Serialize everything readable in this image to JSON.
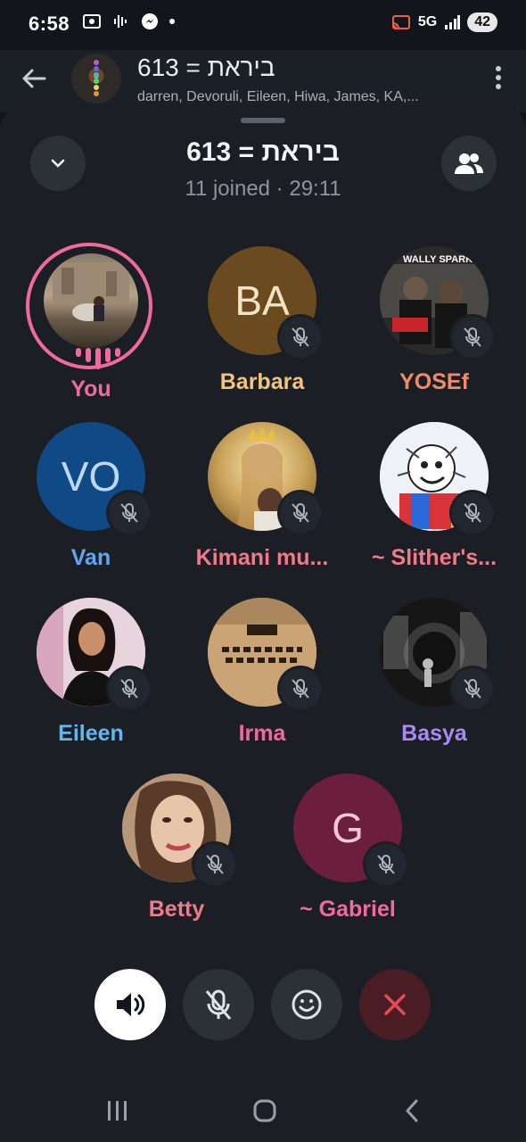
{
  "status_bar": {
    "time": "6:58",
    "network": "5G",
    "battery": "42"
  },
  "chat_header": {
    "title": "ביראת = 613",
    "subtitle": "darren, Devoruli, Eileen, Hiwa, James, KA,..."
  },
  "call": {
    "title": "ביראת = 613",
    "status": "11 joined · 29:11"
  },
  "participants": [
    {
      "name": "You",
      "color": "#f06a9c",
      "speaking": true,
      "initials": ""
    },
    {
      "name": "Barbara",
      "color": "#f3c47a",
      "initials": "BA",
      "bg": "#6a4a1e"
    },
    {
      "name": "YOSEf",
      "color": "#f08a6a",
      "initials": ""
    },
    {
      "name": "Van",
      "color": "#5fa8f0",
      "initials": "VO",
      "bg": "#0f4a86"
    },
    {
      "name": "Kimani mu...",
      "color": "#f07a8a",
      "initials": ""
    },
    {
      "name": "~ Slither's...",
      "color": "#f07a8a",
      "initials": ""
    },
    {
      "name": "Eileen",
      "color": "#5fb8f0",
      "initials": ""
    },
    {
      "name": "Irma",
      "color": "#f06a9c",
      "initials": ""
    },
    {
      "name": "Basya",
      "color": "#a88af0",
      "initials": ""
    },
    {
      "name": "Betty",
      "color": "#f07a8a",
      "initials": ""
    },
    {
      "name": "~ Gabriel",
      "color": "#f06a9c",
      "initials": "G",
      "bg": "#6b1f3d"
    }
  ],
  "colors": {
    "background": "#12151b",
    "sheet": "#1b1f25",
    "end_call": "#e84a58"
  }
}
